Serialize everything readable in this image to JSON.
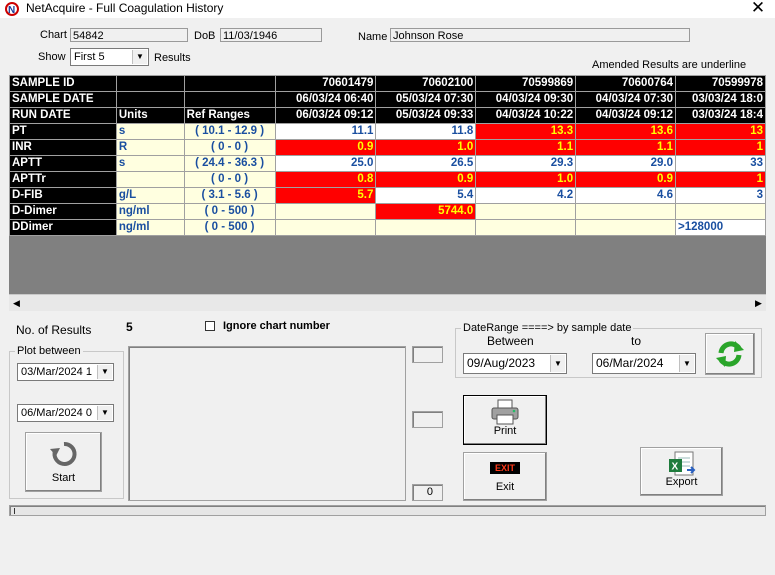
{
  "window": {
    "title": "NetAcquire - Full Coagulation History",
    "close_glyph": "✕"
  },
  "patient": {
    "chart_label": "Chart",
    "chart_value": "54842",
    "dob_label": "DoB",
    "dob_value": "11/03/1946",
    "name_label": "Name",
    "name_value": "Johnson Rose"
  },
  "show": {
    "label": "Show",
    "value": "First 5",
    "suffix": "Results"
  },
  "amended_note": "Amended  Results are underline",
  "grid": {
    "header_rows": [
      {
        "label": "SAMPLE ID",
        "c1": "",
        "c2": "",
        "values": [
          "70601479",
          "70602100",
          "70599869",
          "70600764",
          "70599978"
        ]
      },
      {
        "label": "SAMPLE DATE",
        "c1": "",
        "c2": "",
        "values": [
          "06/03/24 06:40",
          "05/03/24 07:30",
          "04/03/24 09:30",
          "04/03/24 07:30",
          "03/03/24 18:0"
        ]
      },
      {
        "label": "RUN DATE",
        "c1": "Units",
        "c2": "Ref Ranges",
        "values": [
          "06/03/24 09:12",
          "05/03/24 09:33",
          "04/03/24 10:22",
          "04/03/24 09:12",
          "03/03/24 18:4"
        ]
      }
    ],
    "tests": [
      {
        "name": "PT",
        "unit": "s",
        "ref": "( 10.1 - 12.9 )",
        "values": [
          "11.1",
          "11.8",
          "13.3",
          "13.6",
          "13"
        ],
        "flags": [
          false,
          false,
          true,
          true,
          true
        ]
      },
      {
        "name": "INR",
        "unit": "R",
        "ref": "( 0 - 0 )",
        "values": [
          "0.9",
          "1.0",
          "1.1",
          "1.1",
          "1"
        ],
        "flags": [
          true,
          true,
          true,
          true,
          true
        ]
      },
      {
        "name": "APTT",
        "unit": "s",
        "ref": "( 24.4 - 36.3 )",
        "values": [
          "25.0",
          "26.5",
          "29.3",
          "29.0",
          "33"
        ],
        "flags": [
          false,
          false,
          false,
          false,
          false
        ]
      },
      {
        "name": "APTTr",
        "unit": "",
        "ref": "( 0 - 0 )",
        "values": [
          "0.8",
          "0.9",
          "1.0",
          "0.9",
          "1"
        ],
        "flags": [
          true,
          true,
          true,
          true,
          true
        ]
      },
      {
        "name": "D-FIB",
        "unit": "g/L",
        "ref": "( 3.1 - 5.6 )",
        "values": [
          "5.7",
          "5.4",
          "4.2",
          "4.6",
          "3"
        ],
        "flags": [
          true,
          false,
          false,
          false,
          false
        ]
      },
      {
        "name": "D-Dimer",
        "unit": "ng/ml",
        "ref": "( 0 - 500 )",
        "values": [
          "",
          "5744.0",
          "",
          "",
          ""
        ],
        "flags": [
          false,
          true,
          false,
          false,
          false
        ]
      },
      {
        "name": "DDimer",
        "unit": "ng/ml",
        "ref": "( 0 - 500 )",
        "values": [
          "",
          "",
          "",
          "",
          ">128000"
        ],
        "flags": [
          false,
          false,
          false,
          false,
          false
        ]
      }
    ]
  },
  "results": {
    "label": "No. of Results",
    "count": "5"
  },
  "ignore_chart": {
    "label": "Ignore chart number",
    "checked": false
  },
  "plot": {
    "label": "Plot between",
    "from": "03/Mar/2024 1",
    "to": "06/Mar/2024 0",
    "start_label": "Start"
  },
  "counters": {
    "bottom_value": "0"
  },
  "daterange": {
    "label": "DateRange ====> by sample date",
    "between_label": "Between",
    "to_label": "to",
    "from": "09/Aug/2023",
    "to": "06/Mar/2024"
  },
  "buttons": {
    "print": "Print",
    "exit": "Exit",
    "exit_badge": "EXIT",
    "export": "Export"
  },
  "colors": {
    "flag_bg": "#ff0000",
    "flag_fg": "#ffff00",
    "value_fg": "#1a4fa0",
    "label_bg": "#000000"
  }
}
